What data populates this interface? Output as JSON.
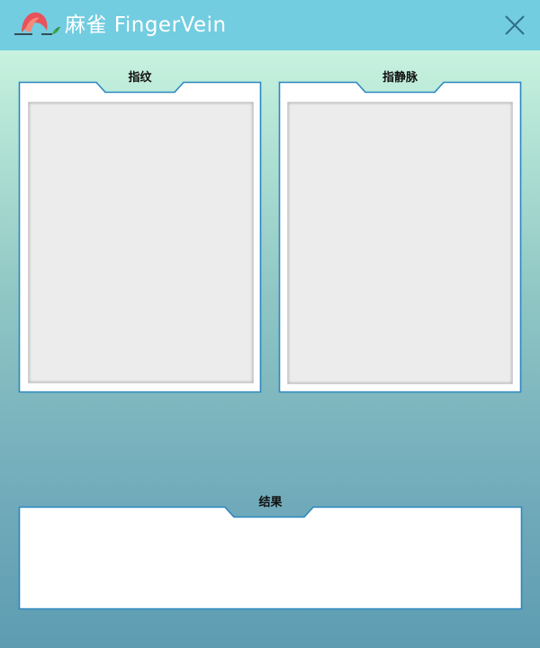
{
  "window": {
    "title": "麻雀 FingerVein",
    "logo_icon": "sparrow-logo-icon",
    "close_icon": "close-icon",
    "titlebar_color": "#72cde0"
  },
  "panels": {
    "fingerprint": {
      "label": "指纹"
    },
    "fingervein": {
      "label": "指静脉"
    },
    "result": {
      "label": "结果",
      "text": ""
    }
  },
  "colors": {
    "frame_border": "#2b87c0",
    "image_placeholder": "#ececec"
  }
}
